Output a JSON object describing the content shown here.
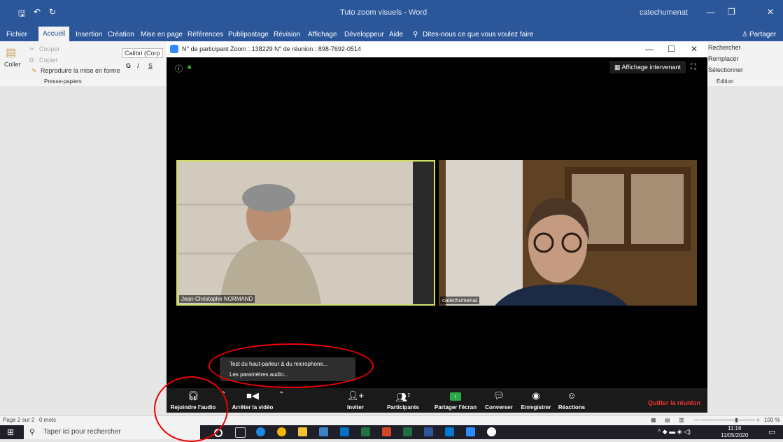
{
  "word": {
    "title": "Tuto zoom visuels - Word",
    "user": "catechumenat",
    "tabs": [
      "Fichier",
      "Accueil",
      "Insertion",
      "Création",
      "Mise en page",
      "Références",
      "Publipostage",
      "Révision",
      "Affichage",
      "Développeur",
      "Aide"
    ],
    "tell_me": "Dites-nous ce que vous voulez faire",
    "share": "Partager",
    "ribbon": {
      "cut": "Couper",
      "copy": "Copier",
      "paste": "Coller",
      "format_painter": "Reproduire la mise en forme",
      "clipboard_group": "Presse-papiers",
      "font": "Calibri (Corp",
      "find": "Rechercher",
      "replace": "Remplacer",
      "select": "Sélectionner",
      "editing_group": "Édition"
    },
    "status": {
      "page": "Page 2 sur 2",
      "words": "0 mots",
      "zoom": "100 %"
    }
  },
  "taskbar": {
    "search_placeholder": "Taper ici pour rechercher",
    "time": "11:16",
    "date": "11/05/2020"
  },
  "zoom": {
    "title": "N° de participant Zoom : 138229   N° de réunion : 898-7692-0514",
    "speaker_view": "Affichage intervenant",
    "participants": [
      {
        "name": "Jean-Christophe NORMAND"
      },
      {
        "name": "catechumenat"
      }
    ],
    "audio_menu": {
      "items": [
        "Test du haut-parleur & du microphone...",
        "Les paramètres audio..."
      ]
    },
    "toolbar": {
      "join_audio": "Rejoindre l'audio",
      "stop_video": "Arrêter la vidéo",
      "invite": "Inviter",
      "participants": "Participants",
      "participants_count": "2",
      "share_screen": "Partager l'écran",
      "chat": "Converser",
      "record": "Enregistrer",
      "reactions": "Réactions",
      "leave": "Quitter la réunion"
    }
  },
  "colors": {
    "word_blue": "#2b579a",
    "active_speaker": "#cfe064",
    "leave_red": "#e33333",
    "annotation_red": "#e00000",
    "share_green": "#2aa845"
  }
}
